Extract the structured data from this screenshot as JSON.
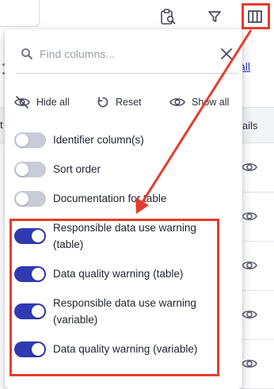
{
  "toolbar": {
    "clipboard_icon": "clipboard-search-icon",
    "filter_icon": "filter-icon",
    "columns_icon": "columns-icon"
  },
  "background": {
    "link_text": "all",
    "table_header_left": "t",
    "table_header_right": "etails",
    "row_icon": "eye-icon"
  },
  "column_picker": {
    "search": {
      "placeholder": "Find columns...",
      "value": ""
    },
    "actions": {
      "hide_all": "Hide all",
      "reset": "Reset",
      "show_all": "Show all"
    },
    "columns": [
      {
        "label": "Identifier column(s)",
        "enabled": false
      },
      {
        "label": "Sort order",
        "enabled": false
      },
      {
        "label": "Documentation for table",
        "enabled": false
      },
      {
        "label": "Responsible data use warning (table)",
        "enabled": true
      },
      {
        "label": "Data quality warning (table)",
        "enabled": true
      },
      {
        "label": "Responsible data use warning (variable)",
        "enabled": true
      },
      {
        "label": "Data quality warning (variable)",
        "enabled": true
      }
    ]
  },
  "annotation_colors": {
    "highlight": "#e63b2e",
    "toggle_on": "#2f3ab2",
    "toggle_off": "#c8ccd6"
  }
}
